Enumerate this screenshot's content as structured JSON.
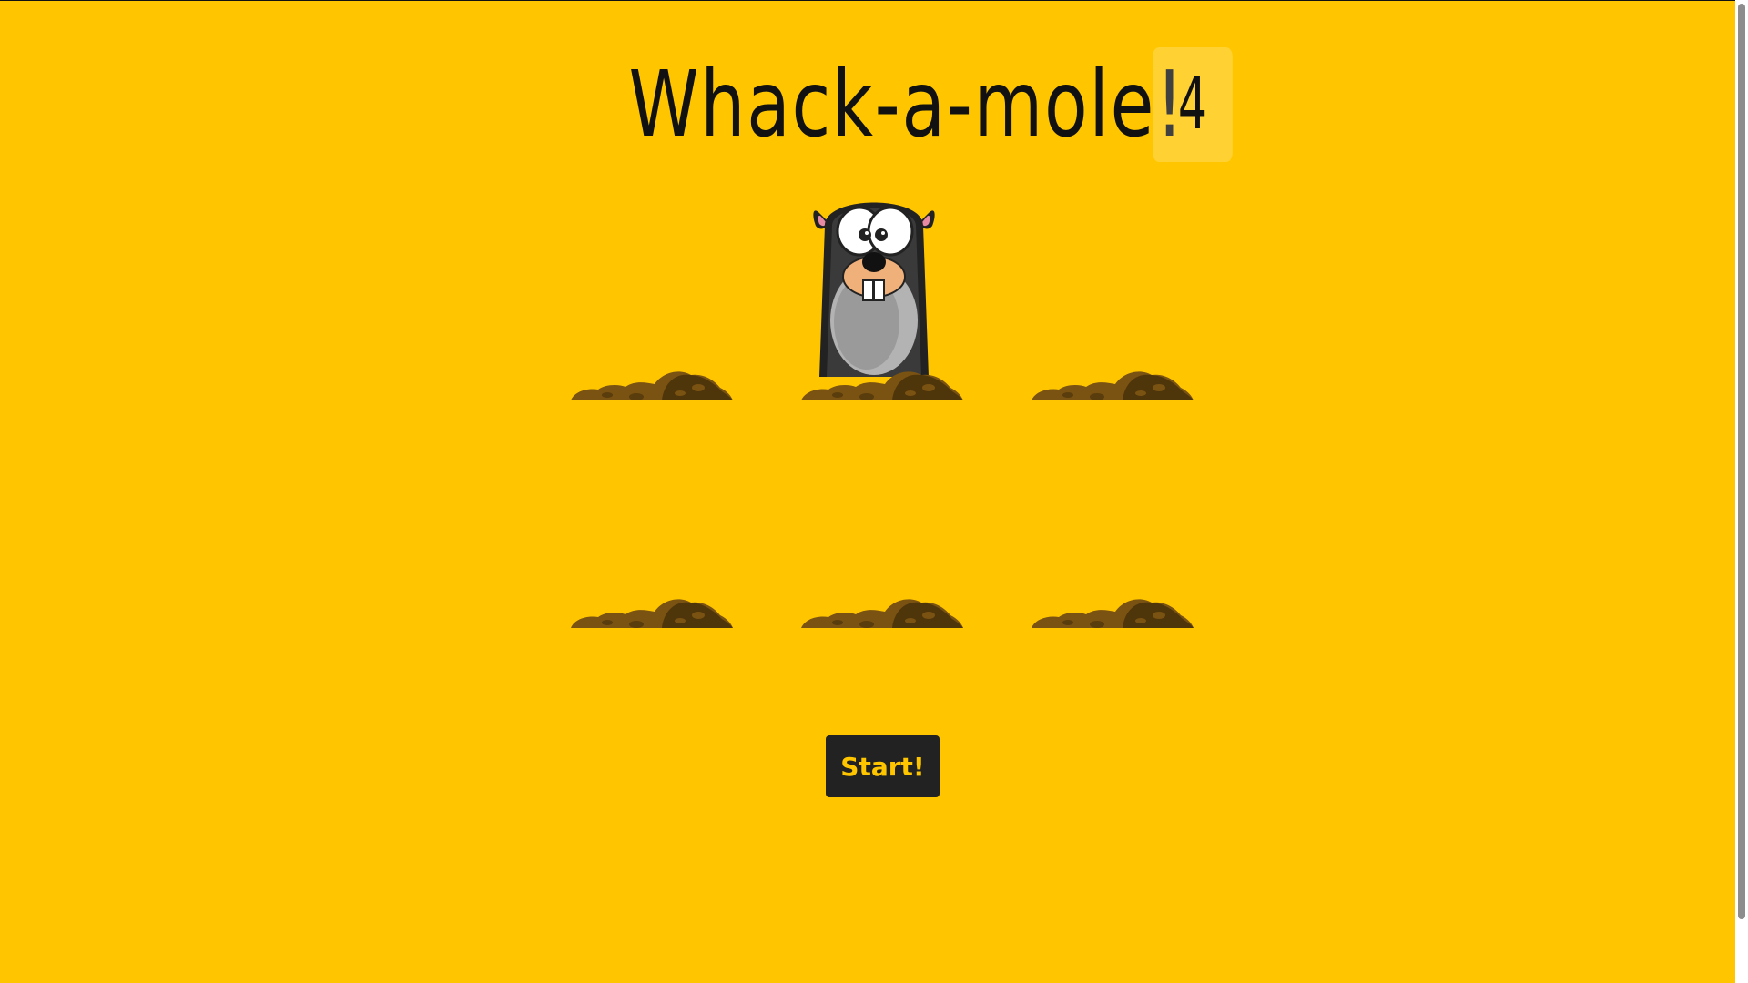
{
  "game": {
    "title": "Whack-a-mole!",
    "score": "4",
    "start_label": "Start!",
    "active_hole": 2,
    "holes": [
      1,
      2,
      3,
      4,
      5,
      6
    ]
  },
  "colors": {
    "background": "#ffc600",
    "button": "#222222",
    "button_text": "#ffc600",
    "dirt": "#6b4a12"
  }
}
